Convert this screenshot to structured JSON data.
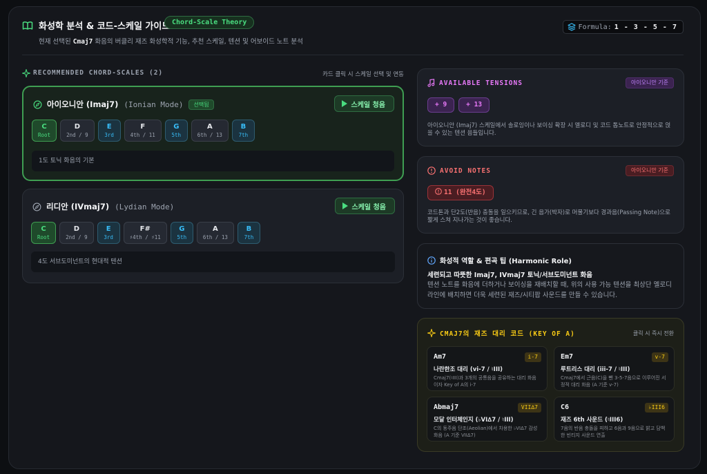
{
  "header": {
    "title": "화성학 분석 & 코드-스케일 가이드",
    "theory_badge": "Chord-Scale Theory",
    "subtitle_prefix": "현재 선택된",
    "subtitle_chord": "Cmaj7",
    "subtitle_suffix": "화음의 버클리 재즈 화성학적 기능, 추천 스케일, 텐션 및 어보이드 노트 분석",
    "formula_label": "Formula:",
    "formula_value": "1 - 3 - 5 - 7"
  },
  "recommended": {
    "title": "RECOMMENDED CHORD-SCALES (2)",
    "hint": "카드 클릭 시 스케일 선택 및 연동",
    "play_label": "스케일 청음",
    "selected_badge": "선택됨",
    "scales": [
      {
        "name": "아이오니안 (Imaj7)",
        "mode": "(Ionian Mode)",
        "selected": true,
        "notes": [
          {
            "n": "C",
            "f": "Root",
            "type": "root"
          },
          {
            "n": "D",
            "f": "2nd / 9",
            "type": "plain"
          },
          {
            "n": "E",
            "f": "3rd",
            "type": "chord"
          },
          {
            "n": "F",
            "f": "4th / 11",
            "type": "plain"
          },
          {
            "n": "G",
            "f": "5th",
            "type": "chord"
          },
          {
            "n": "A",
            "f": "6th / 13",
            "type": "plain"
          },
          {
            "n": "B",
            "f": "7th",
            "type": "chord"
          }
        ],
        "desc": "1도 토닉 화음의 기본"
      },
      {
        "name": "리디안 (IVmaj7)",
        "mode": "(Lydian Mode)",
        "selected": false,
        "notes": [
          {
            "n": "C",
            "f": "Root",
            "type": "root"
          },
          {
            "n": "D",
            "f": "2nd / 9",
            "type": "plain"
          },
          {
            "n": "E",
            "f": "3rd",
            "type": "chord"
          },
          {
            "n": "F#",
            "f": "♯4th / ♯11",
            "type": "plain"
          },
          {
            "n": "G",
            "f": "5th",
            "type": "chord"
          },
          {
            "n": "A",
            "f": "6th / 13",
            "type": "plain"
          },
          {
            "n": "B",
            "f": "7th",
            "type": "chord"
          }
        ],
        "desc": "4도 서브도미넌트의 현대적 텐션"
      }
    ]
  },
  "tensions": {
    "title": "AVAILABLE TENSIONS",
    "basis": "아이오니안 기준",
    "items": [
      "+ 9",
      "+ 13"
    ],
    "desc": "아이오니안 (Imaj7) 스케일에서 솔로잉이나 보이싱 확장 시 멜로디 및 코드 톱노트로 안정적으로 얹을 수 있는 텐션 음들입니다."
  },
  "avoid": {
    "title": "AVOID NOTES",
    "basis": "아이오니안 기준",
    "note": "11 (완전4도)",
    "desc": "코드톤과 단2도(반음) 충돌을 일으키므로, 긴 음가(박자)로 머물기보다 경과음(Passing Note)으로 짧게 스쳐 지나가는 것이 좋습니다."
  },
  "role": {
    "title": "화성적 역할 & 편곡 팁 (Harmonic Role)",
    "subtitle": "세련되고 따뜻한 Imaj7, IVmaj7 토닉/서브도미넌트 화음",
    "body": "텐션 노트를 화음에 더하거나 보이싱을 재배치할 때, 위의 사용 가능 텐션을 최상단 멜로디 라인에 배치하면 더욱 세련된 재즈/시티팝 사운드를 만들 수 있습니다."
  },
  "subs": {
    "title": "CMAJ7의 재즈 대리 코드 (KEY OF A)",
    "hint": "클릭 시 즉시 전환",
    "items": [
      {
        "name": "Am7",
        "roman": "i-7",
        "label": "나란한조 대리 (vi-7 / ♮III)",
        "desc": "Cmaj7(♮III)과 3개의 공통음을 공유하는 대리 화음이자 Key of A의 i-7"
      },
      {
        "name": "Em7",
        "roman": "v-7",
        "label": "루트리스 대리 (iii-7 / ♮III)",
        "desc": "Cmaj7에서 근음(C)을 뺀 3-5-7음으로 이루어진 서정적 대리 화음 (A 기준 v-7)"
      },
      {
        "name": "Abmaj7",
        "roman": "VII∆7",
        "label": "모달 인터체인지 (♭VI∆7 / ♮III)",
        "desc": "C의 동주음 단조(Aeolian)에서 차용한 ♭VI∆7 감성 화음 (A 기준 VII∆7)"
      },
      {
        "name": "C6",
        "roman": "♭III6",
        "label": "재즈 6th 사운드 (♮III6)",
        "desc": "7음의 반음 충돌을 피하고 6음과 9음으로 밝고 담백한 빈티지 사운드 연출"
      }
    ]
  },
  "colors": {
    "accent_green": "#4ade80",
    "chord_tone_blue": "#38bdf8",
    "tension_purple": "#e879f9",
    "avoid_red": "#f87171",
    "sub_yellow": "#facc15"
  }
}
